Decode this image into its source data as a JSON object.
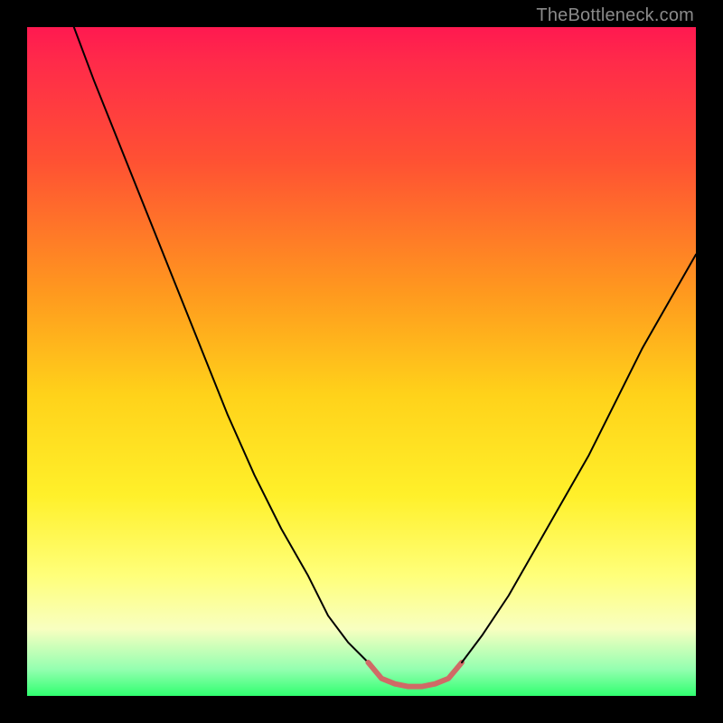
{
  "watermark": {
    "text": "TheBottleneck.com"
  },
  "chart_data": {
    "type": "line",
    "title": "",
    "xlabel": "",
    "ylabel": "",
    "xlim": [
      0,
      100
    ],
    "ylim": [
      0,
      100
    ],
    "gradient_stops": [
      {
        "pos": 0,
        "color": "#ff1950"
      },
      {
        "pos": 20,
        "color": "#ff5133"
      },
      {
        "pos": 40,
        "color": "#ff9a1e"
      },
      {
        "pos": 55,
        "color": "#ffd21a"
      },
      {
        "pos": 70,
        "color": "#fff02a"
      },
      {
        "pos": 82,
        "color": "#ffff7a"
      },
      {
        "pos": 90,
        "color": "#f8ffc0"
      },
      {
        "pos": 96,
        "color": "#94ffb0"
      },
      {
        "pos": 100,
        "color": "#30ff70"
      }
    ],
    "comment": "x in 0-100 is horizontal position left→right, y in 0-100 is vertical (0 bottom, 100 top).",
    "series": [
      {
        "name": "left-descent",
        "color": "#000000",
        "stroke_width": 2,
        "values_xy": [
          [
            7,
            100
          ],
          [
            10,
            92
          ],
          [
            14,
            82
          ],
          [
            18,
            72
          ],
          [
            22,
            62
          ],
          [
            26,
            52
          ],
          [
            30,
            42
          ],
          [
            34,
            33
          ],
          [
            38,
            25
          ],
          [
            42,
            18
          ],
          [
            45,
            12
          ],
          [
            48,
            8
          ],
          [
            51,
            5
          ]
        ]
      },
      {
        "name": "trough",
        "color": "#d06a66",
        "stroke_width": 6,
        "values_xy": [
          [
            51,
            5
          ],
          [
            53,
            2.6
          ],
          [
            55,
            1.8
          ],
          [
            57,
            1.4
          ],
          [
            59,
            1.4
          ],
          [
            61,
            1.8
          ],
          [
            63,
            2.6
          ],
          [
            65,
            5
          ]
        ]
      },
      {
        "name": "right-ascent",
        "color": "#000000",
        "stroke_width": 2,
        "values_xy": [
          [
            65,
            5
          ],
          [
            68,
            9
          ],
          [
            72,
            15
          ],
          [
            76,
            22
          ],
          [
            80,
            29
          ],
          [
            84,
            36
          ],
          [
            88,
            44
          ],
          [
            92,
            52
          ],
          [
            96,
            59
          ],
          [
            100,
            66
          ]
        ]
      }
    ],
    "annotations": []
  }
}
